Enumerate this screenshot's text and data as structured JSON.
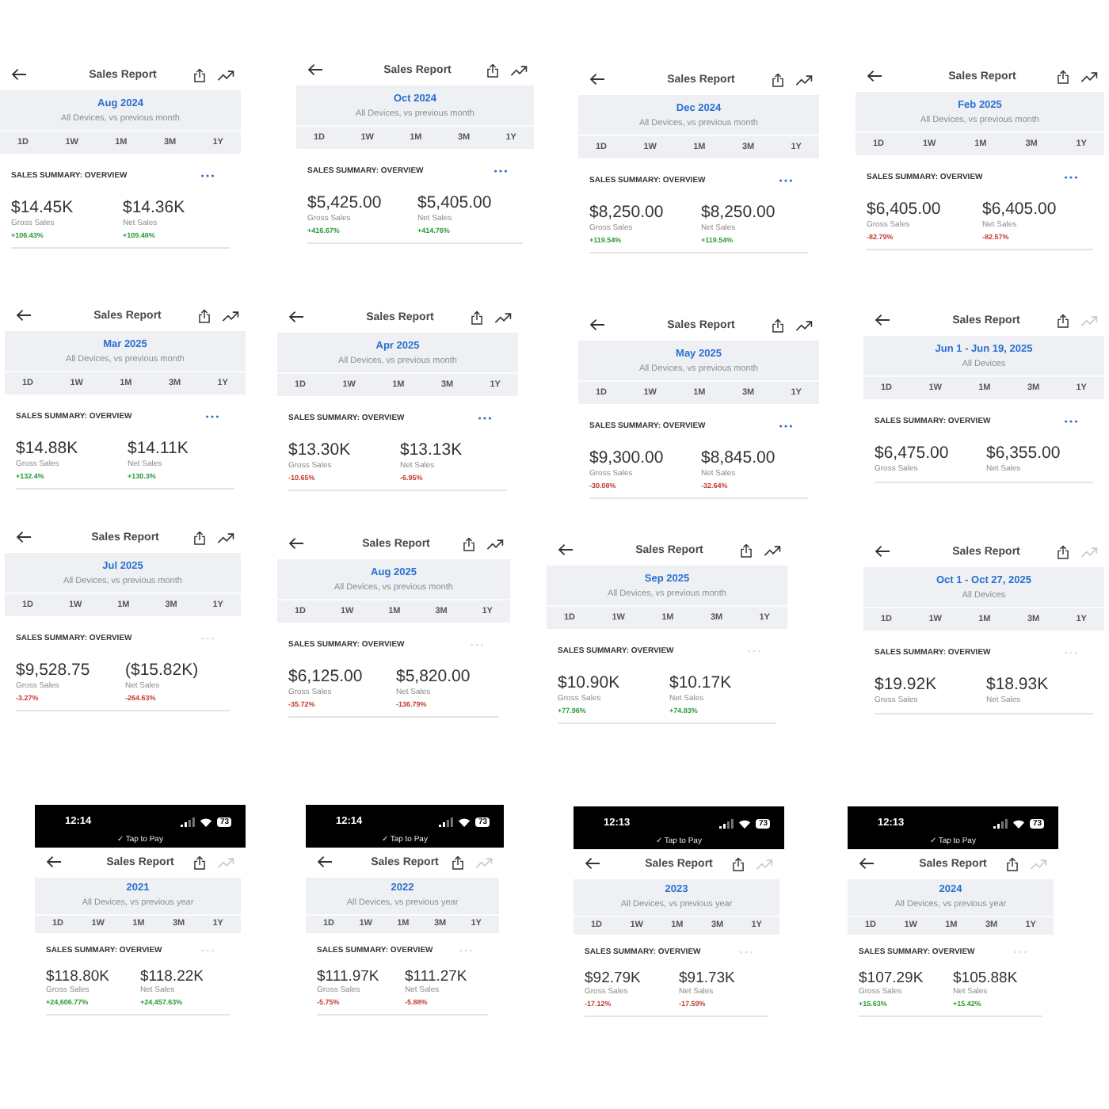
{
  "screens": [
    {
      "header": {
        "title": "Sales Report",
        "trend_enabled": true
      },
      "period": {
        "date": "Aug 2024",
        "subtitle": "All Devices, vs previous month"
      },
      "range_tabs": [
        "1D",
        "1W",
        "1M",
        "3M",
        "1Y"
      ],
      "summary": {
        "title": "SALES SUMMARY: OVERVIEW",
        "more_enabled": true
      },
      "metrics": [
        {
          "value": "$14.45K",
          "label": "Gross Sales",
          "change": "+106.43%",
          "color": "#2e9b3a"
        },
        {
          "value": "$14.36K",
          "label": "Net Sales",
          "change": "+109.48%",
          "color": "#2e9b3a"
        }
      ]
    },
    {
      "header": {
        "title": "Sales Report",
        "trend_enabled": true
      },
      "period": {
        "date": "Oct 2024",
        "subtitle": "All Devices, vs previous month"
      },
      "range_tabs": [
        "1D",
        "1W",
        "1M",
        "3M",
        "1Y"
      ],
      "summary": {
        "title": "SALES SUMMARY: OVERVIEW",
        "more_enabled": true
      },
      "metrics": [
        {
          "value": "$5,425.00",
          "label": "Gross Sales",
          "change": "+416.67%",
          "color": "#2e9b3a"
        },
        {
          "value": "$5,405.00",
          "label": "Net Sales",
          "change": "+414.76%",
          "color": "#2e9b3a"
        }
      ]
    },
    {
      "header": {
        "title": "Sales Report",
        "trend_enabled": true
      },
      "period": {
        "date": "Dec 2024",
        "subtitle": "All Devices, vs previous month"
      },
      "range_tabs": [
        "1D",
        "1W",
        "1M",
        "3M",
        "1Y"
      ],
      "summary": {
        "title": "SALES SUMMARY: OVERVIEW",
        "more_enabled": true
      },
      "metrics": [
        {
          "value": "$8,250.00",
          "label": "Gross Sales",
          "change": "+119.54%",
          "color": "#2e9b3a"
        },
        {
          "value": "$8,250.00",
          "label": "Net Sales",
          "change": "+119.54%",
          "color": "#2e9b3a"
        }
      ]
    },
    {
      "header": {
        "title": "Sales Report",
        "trend_enabled": true
      },
      "period": {
        "date": "Feb 2025",
        "subtitle": "All Devices, vs previous month"
      },
      "range_tabs": [
        "1D",
        "1W",
        "1M",
        "3M",
        "1Y"
      ],
      "summary": {
        "title": "SALES SUMMARY: OVERVIEW",
        "more_enabled": true
      },
      "metrics": [
        {
          "value": "$6,405.00",
          "label": "Gross Sales",
          "change": "-82.79%",
          "color": "#c23b33"
        },
        {
          "value": "$6,405.00",
          "label": "Net Sales",
          "change": "-82.57%",
          "color": "#c23b33"
        }
      ]
    },
    {
      "header": {
        "title": "Sales Report",
        "trend_enabled": true
      },
      "period": {
        "date": "Mar 2025",
        "subtitle": "All Devices, vs previous month"
      },
      "range_tabs": [
        "1D",
        "1W",
        "1M",
        "3M",
        "1Y"
      ],
      "summary": {
        "title": "SALES SUMMARY: OVERVIEW",
        "more_enabled": true
      },
      "metrics": [
        {
          "value": "$14.88K",
          "label": "Gross Sales",
          "change": "+132.4%",
          "color": "#2e9b3a"
        },
        {
          "value": "$14.11K",
          "label": "Net Sales",
          "change": "+130.3%",
          "color": "#2e9b3a"
        }
      ]
    },
    {
      "header": {
        "title": "Sales Report",
        "trend_enabled": true
      },
      "period": {
        "date": "Apr 2025",
        "subtitle": "All Devices, vs previous month"
      },
      "range_tabs": [
        "1D",
        "1W",
        "1M",
        "3M",
        "1Y"
      ],
      "summary": {
        "title": "SALES SUMMARY: OVERVIEW",
        "more_enabled": true
      },
      "metrics": [
        {
          "value": "$13.30K",
          "label": "Gross Sales",
          "change": "-10.65%",
          "color": "#c23b33"
        },
        {
          "value": "$13.13K",
          "label": "Net Sales",
          "change": "-6.95%",
          "color": "#c23b33"
        }
      ]
    },
    {
      "header": {
        "title": "Sales Report",
        "trend_enabled": true
      },
      "period": {
        "date": "May 2025",
        "subtitle": "All Devices, vs previous month"
      },
      "range_tabs": [
        "1D",
        "1W",
        "1M",
        "3M",
        "1Y"
      ],
      "summary": {
        "title": "SALES SUMMARY: OVERVIEW",
        "more_enabled": true
      },
      "metrics": [
        {
          "value": "$9,300.00",
          "label": "Gross Sales",
          "change": "-30.08%",
          "color": "#c23b33"
        },
        {
          "value": "$8,845.00",
          "label": "Net Sales",
          "change": "-32.64%",
          "color": "#c23b33"
        }
      ]
    },
    {
      "header": {
        "title": "Sales Report",
        "trend_enabled": false
      },
      "period": {
        "date": "Jun 1 - Jun 19, 2025",
        "subtitle": "All Devices"
      },
      "range_tabs": [
        "1D",
        "1W",
        "1M",
        "3M",
        "1Y"
      ],
      "summary": {
        "title": "SALES SUMMARY: OVERVIEW",
        "more_enabled": true
      },
      "metrics": [
        {
          "value": "$6,475.00",
          "label": "Gross Sales"
        },
        {
          "value": "$6,355.00",
          "label": "Net Sales"
        }
      ]
    },
    {
      "header": {
        "title": "Sales Report",
        "trend_enabled": true
      },
      "period": {
        "date": "Jul 2025",
        "subtitle": "All Devices, vs previous month"
      },
      "range_tabs": [
        "1D",
        "1W",
        "1M",
        "3M",
        "1Y"
      ],
      "summary": {
        "title": "SALES SUMMARY: OVERVIEW",
        "more_enabled": false
      },
      "metrics": [
        {
          "value": "$9,528.75",
          "label": "Gross Sales",
          "change": "-3.27%",
          "color": "#c23b33"
        },
        {
          "value": "($15.82K)",
          "label": "Net Sales",
          "change": "-264.63%",
          "color": "#c23b33"
        }
      ]
    },
    {
      "header": {
        "title": "Sales Report",
        "trend_enabled": true
      },
      "period": {
        "date": "Aug 2025",
        "subtitle": "All Devices, vs previous month"
      },
      "range_tabs": [
        "1D",
        "1W",
        "1M",
        "3M",
        "1Y"
      ],
      "summary": {
        "title": "SALES SUMMARY: OVERVIEW",
        "more_enabled": false
      },
      "metrics": [
        {
          "value": "$6,125.00",
          "label": "Gross Sales",
          "change": "-35.72%",
          "color": "#c23b33"
        },
        {
          "value": "$5,820.00",
          "label": "Net Sales",
          "change": "-136.79%",
          "color": "#c23b33"
        }
      ]
    },
    {
      "header": {
        "title": "Sales Report",
        "trend_enabled": true
      },
      "period": {
        "date": "Sep 2025",
        "subtitle": "All Devices, vs previous month"
      },
      "range_tabs": [
        "1D",
        "1W",
        "1M",
        "3M",
        "1Y"
      ],
      "summary": {
        "title": "SALES SUMMARY: OVERVIEW",
        "more_enabled": false
      },
      "metrics": [
        {
          "value": "$10.90K",
          "label": "Gross Sales",
          "change": "+77.96%",
          "color": "#2e9b3a"
        },
        {
          "value": "$10.17K",
          "label": "Net Sales",
          "change": "+74.83%",
          "color": "#2e9b3a"
        }
      ]
    },
    {
      "header": {
        "title": "Sales Report",
        "trend_enabled": false
      },
      "period": {
        "date": "Oct 1 - Oct 27, 2025",
        "subtitle": "All Devices"
      },
      "range_tabs": [
        "1D",
        "1W",
        "1M",
        "3M",
        "1Y"
      ],
      "summary": {
        "title": "SALES SUMMARY: OVERVIEW",
        "more_enabled": false
      },
      "metrics": [
        {
          "value": "$19.92K",
          "label": "Gross Sales"
        },
        {
          "value": "$18.93K",
          "label": "Net Sales"
        }
      ]
    },
    {
      "status_bar": {
        "time": "12:14",
        "battery": "73",
        "banner": "✓ Tap to Pay"
      },
      "header": {
        "title": "Sales Report",
        "trend_enabled": false
      },
      "period": {
        "date": "2021",
        "subtitle": "All Devices, vs previous year"
      },
      "range_tabs": [
        "1D",
        "1W",
        "1M",
        "3M",
        "1Y"
      ],
      "summary": {
        "title": "SALES SUMMARY: OVERVIEW",
        "more_enabled": false
      },
      "metrics": [
        {
          "value": "$118.80K",
          "label": "Gross Sales",
          "change": "+24,606.77%",
          "color": "#2e9b3a"
        },
        {
          "value": "$118.22K",
          "label": "Net Sales",
          "change": "+24,457.63%",
          "color": "#2e9b3a"
        }
      ]
    },
    {
      "status_bar": {
        "time": "12:14",
        "battery": "73",
        "banner": "✓ Tap to Pay"
      },
      "header": {
        "title": "Sales Report",
        "trend_enabled": false
      },
      "period": {
        "date": "2022",
        "subtitle": "All Devices, vs previous year"
      },
      "range_tabs": [
        "1D",
        "1W",
        "1M",
        "3M",
        "1Y"
      ],
      "summary": {
        "title": "SALES SUMMARY: OVERVIEW",
        "more_enabled": false
      },
      "metrics": [
        {
          "value": "$111.97K",
          "label": "Gross Sales",
          "change": "-5.75%",
          "color": "#c23b33"
        },
        {
          "value": "$111.27K",
          "label": "Net Sales",
          "change": "-5.88%",
          "color": "#c23b33"
        }
      ]
    },
    {
      "status_bar": {
        "time": "12:13",
        "battery": "73",
        "banner": "✓ Tap to Pay"
      },
      "header": {
        "title": "Sales Report",
        "trend_enabled": false
      },
      "period": {
        "date": "2023",
        "subtitle": "All Devices, vs previous year"
      },
      "range_tabs": [
        "1D",
        "1W",
        "1M",
        "3M",
        "1Y"
      ],
      "summary": {
        "title": "SALES SUMMARY: OVERVIEW",
        "more_enabled": false
      },
      "metrics": [
        {
          "value": "$92.79K",
          "label": "Gross Sales",
          "change": "-17.12%",
          "color": "#c23b33"
        },
        {
          "value": "$91.73K",
          "label": "Net Sales",
          "change": "-17.59%",
          "color": "#c23b33"
        }
      ]
    },
    {
      "status_bar": {
        "time": "12:13",
        "battery": "73",
        "banner": "✓ Tap to Pay"
      },
      "header": {
        "title": "Sales Report",
        "trend_enabled": false
      },
      "period": {
        "date": "2024",
        "subtitle": "All Devices, vs previous year"
      },
      "range_tabs": [
        "1D",
        "1W",
        "1M",
        "3M",
        "1Y"
      ],
      "summary": {
        "title": "SALES SUMMARY: OVERVIEW",
        "more_enabled": false
      },
      "metrics": [
        {
          "value": "$107.29K",
          "label": "Gross Sales",
          "change": "+15.63%",
          "color": "#2e9b3a"
        },
        {
          "value": "$105.88K",
          "label": "Net Sales",
          "change": "+15.42%",
          "color": "#2e9b3a"
        }
      ]
    }
  ]
}
